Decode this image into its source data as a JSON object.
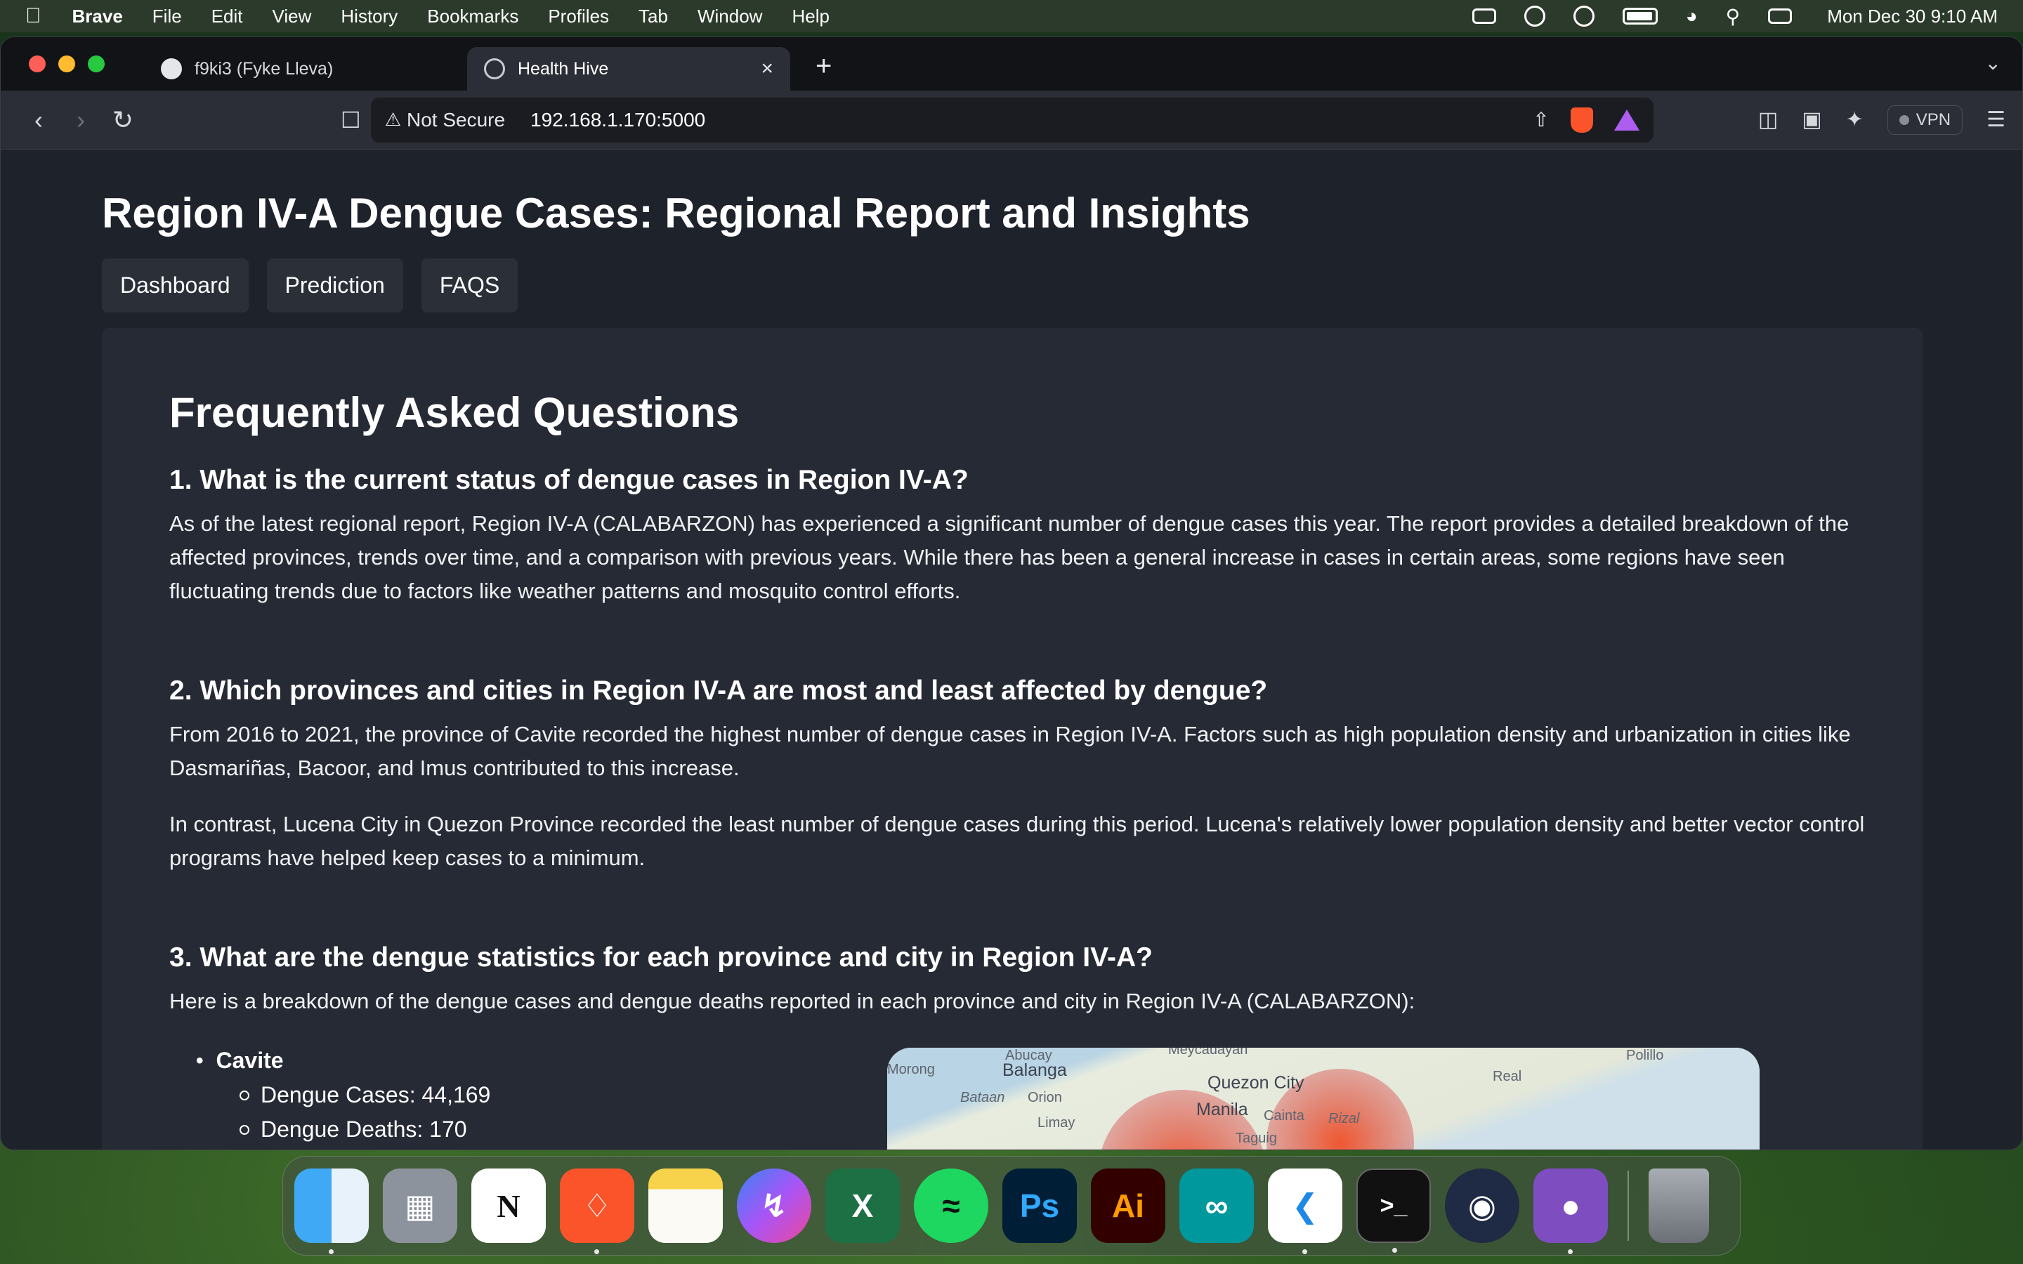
{
  "menubar": {
    "app_name": "Brave",
    "items": [
      "File",
      "Edit",
      "View",
      "History",
      "Bookmarks",
      "Profiles",
      "Tab",
      "Window",
      "Help"
    ],
    "clock": "Mon Dec 30  9:10 AM",
    "status_icons": [
      "screen-record-icon",
      "creative-cloud-icon",
      "user-icon",
      "battery-icon",
      "wifi-icon",
      "spotlight-icon",
      "control-center-icon"
    ]
  },
  "browser": {
    "tabs": [
      {
        "label": "f9ki3 (Fyke Lleva)",
        "icon": "github-icon",
        "active": false
      },
      {
        "label": "Health Hive",
        "icon": "globe-icon",
        "active": true
      }
    ],
    "new_tab": "+",
    "url_bar": {
      "security_label": "Not Secure",
      "url": "192.168.1.170:5000"
    },
    "vpn_label": "VPN"
  },
  "page": {
    "title": "Region IV-A Dengue Cases: Regional Report and Insights",
    "nav": [
      "Dashboard",
      "Prediction",
      "FAQS"
    ],
    "faq_heading": "Frequently Asked Questions",
    "faqs": [
      {
        "question": "1. What is the current status of dengue cases in Region IV-A?",
        "answers": [
          "As of the latest regional report, Region IV-A (CALABARZON) has experienced a significant number of dengue cases this year. The report provides a detailed breakdown of the affected provinces, trends over time, and a comparison with previous years. While there has been a general increase in cases in certain areas, some regions have seen fluctuating trends due to factors like weather patterns and mosquito control efforts."
        ]
      },
      {
        "question": "2. Which provinces and cities in Region IV-A are most and least affected by dengue?",
        "answers": [
          "From 2016 to 2021, the province of Cavite recorded the highest number of dengue cases in Region IV-A. Factors such as high population density and urbanization in cities like Dasmariñas, Bacoor, and Imus contributed to this increase.",
          "In contrast, Lucena City in Quezon Province recorded the least number of dengue cases during this period. Lucena's relatively lower population density and better vector control programs have helped keep cases to a minimum."
        ]
      },
      {
        "question": "3. What are the dengue statistics for each province and city in Region IV-A?",
        "answers": [
          "Here is a breakdown of the dengue cases and dengue deaths reported in each province and city in Region IV-A (CALABARZON):"
        ]
      }
    ],
    "stats": [
      {
        "name": "Cavite",
        "cases": "Dengue Cases: 44,169",
        "deaths": "Dengue Deaths: 170"
      }
    ],
    "map_labels": [
      "Abucay",
      "Morong",
      "Balanga",
      "Orion",
      "Bataan",
      "Limay",
      "Quezon City",
      "Manila",
      "Real",
      "Polillo",
      "Cainta",
      "Rizal",
      "Taguig",
      "Meycauayan"
    ]
  },
  "dock": {
    "apps": [
      "Finder",
      "Launchpad",
      "Notion",
      "Brave",
      "Notes",
      "Messenger",
      "Excel",
      "Spotify",
      "Photoshop",
      "Illustrator",
      "Arduino",
      "VS Code",
      "Terminal",
      "Screenshot",
      "GitHub Desktop",
      "Trash"
    ],
    "glyphs": {
      "notion": "N",
      "photoshop": "Ps",
      "illustrator": "Ai",
      "excel": "X"
    }
  }
}
